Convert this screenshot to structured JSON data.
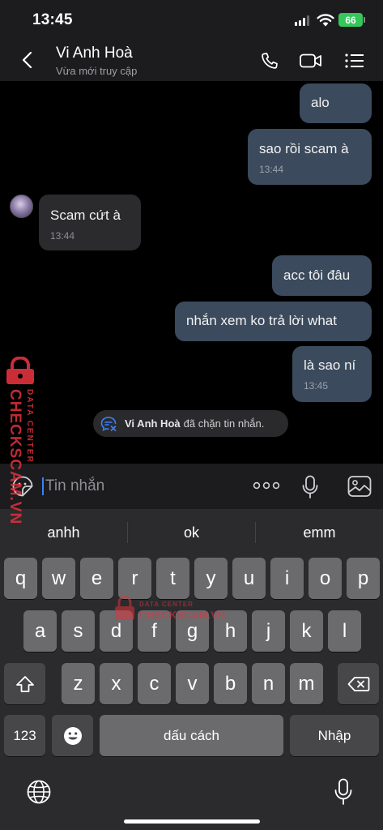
{
  "status_bar": {
    "time": "13:45",
    "battery": "66"
  },
  "header": {
    "contact_name": "Vi Anh Hoà",
    "contact_status": "Vừa mới truy cập"
  },
  "messages": [
    {
      "direction": "out",
      "text": "alo",
      "time": ""
    },
    {
      "direction": "out",
      "text": "sao rồi scam à",
      "time": "13:44"
    },
    {
      "direction": "in",
      "text": "Scam cứt à",
      "time": "13:44"
    },
    {
      "direction": "out",
      "text": "acc tôi đâu",
      "time": ""
    },
    {
      "direction": "out",
      "text": "nhắn xem ko trả lời what",
      "time": ""
    },
    {
      "direction": "out",
      "text": "là sao ní",
      "time": "13:45"
    }
  ],
  "system_notice": {
    "name": "Vi Anh Hoà",
    "text": "đã chặn tin nhắn."
  },
  "input": {
    "placeholder": "Tin nhắn"
  },
  "keyboard": {
    "suggestions": [
      "anhh",
      "ok",
      "emm"
    ],
    "row1": [
      "q",
      "w",
      "e",
      "r",
      "t",
      "y",
      "u",
      "i",
      "o",
      "p"
    ],
    "row2": [
      "a",
      "s",
      "d",
      "f",
      "g",
      "h",
      "j",
      "k",
      "l"
    ],
    "row3": [
      "z",
      "x",
      "c",
      "v",
      "b",
      "n",
      "m"
    ],
    "numbers_key": "123",
    "space_key": "dấu cách",
    "return_key": "Nhập"
  },
  "watermark": {
    "brand": "CHECKSCAM.VN",
    "tagline": "DATA CENTER"
  },
  "colors": {
    "outgoing_bubble": "#3b4a5c",
    "incoming_bubble": "#2b2b2e",
    "battery": "#34c759",
    "caret": "#3b82f6",
    "watermark": "#e0323c"
  }
}
